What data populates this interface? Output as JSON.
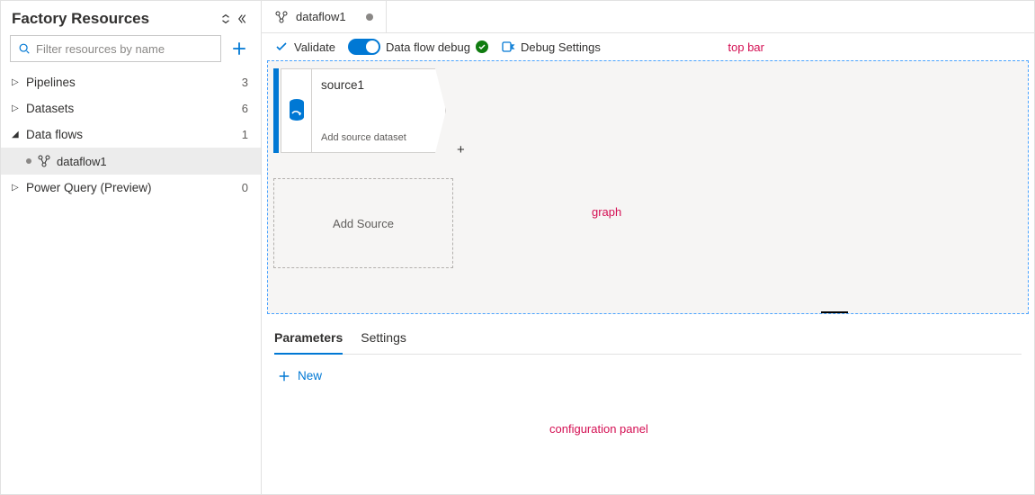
{
  "sidebar": {
    "title": "Factory Resources",
    "search_placeholder": "Filter resources by name",
    "items": [
      {
        "label": "Pipelines",
        "count": "3",
        "expanded": false,
        "children": []
      },
      {
        "label": "Datasets",
        "count": "6",
        "expanded": false,
        "children": []
      },
      {
        "label": "Data flows",
        "count": "1",
        "expanded": true,
        "children": [
          {
            "label": "dataflow1",
            "unsaved": true
          }
        ]
      },
      {
        "label": "Power Query (Preview)",
        "count": "0",
        "expanded": false,
        "children": []
      }
    ]
  },
  "tabs": [
    {
      "label": "dataflow1",
      "icon": "dataflow-icon",
      "dirty": true
    }
  ],
  "toolbar": {
    "validate_label": "Validate",
    "debug_toggle_label": "Data flow debug",
    "debug_toggle_on": true,
    "debug_status_ok": true,
    "debug_settings_label": "Debug Settings"
  },
  "graph": {
    "node": {
      "name": "source1",
      "subtitle": "Add source dataset"
    },
    "add_source_label": "Add Source"
  },
  "config": {
    "tabs": [
      {
        "label": "Parameters",
        "active": true
      },
      {
        "label": "Settings",
        "active": false
      }
    ],
    "new_label": "New"
  },
  "annotations": {
    "top_bar": "top bar",
    "graph": "graph",
    "config": "configuration panel"
  },
  "colors": {
    "accent": "#0078d4",
    "success": "#107c10",
    "annotation": "#d40e52"
  }
}
